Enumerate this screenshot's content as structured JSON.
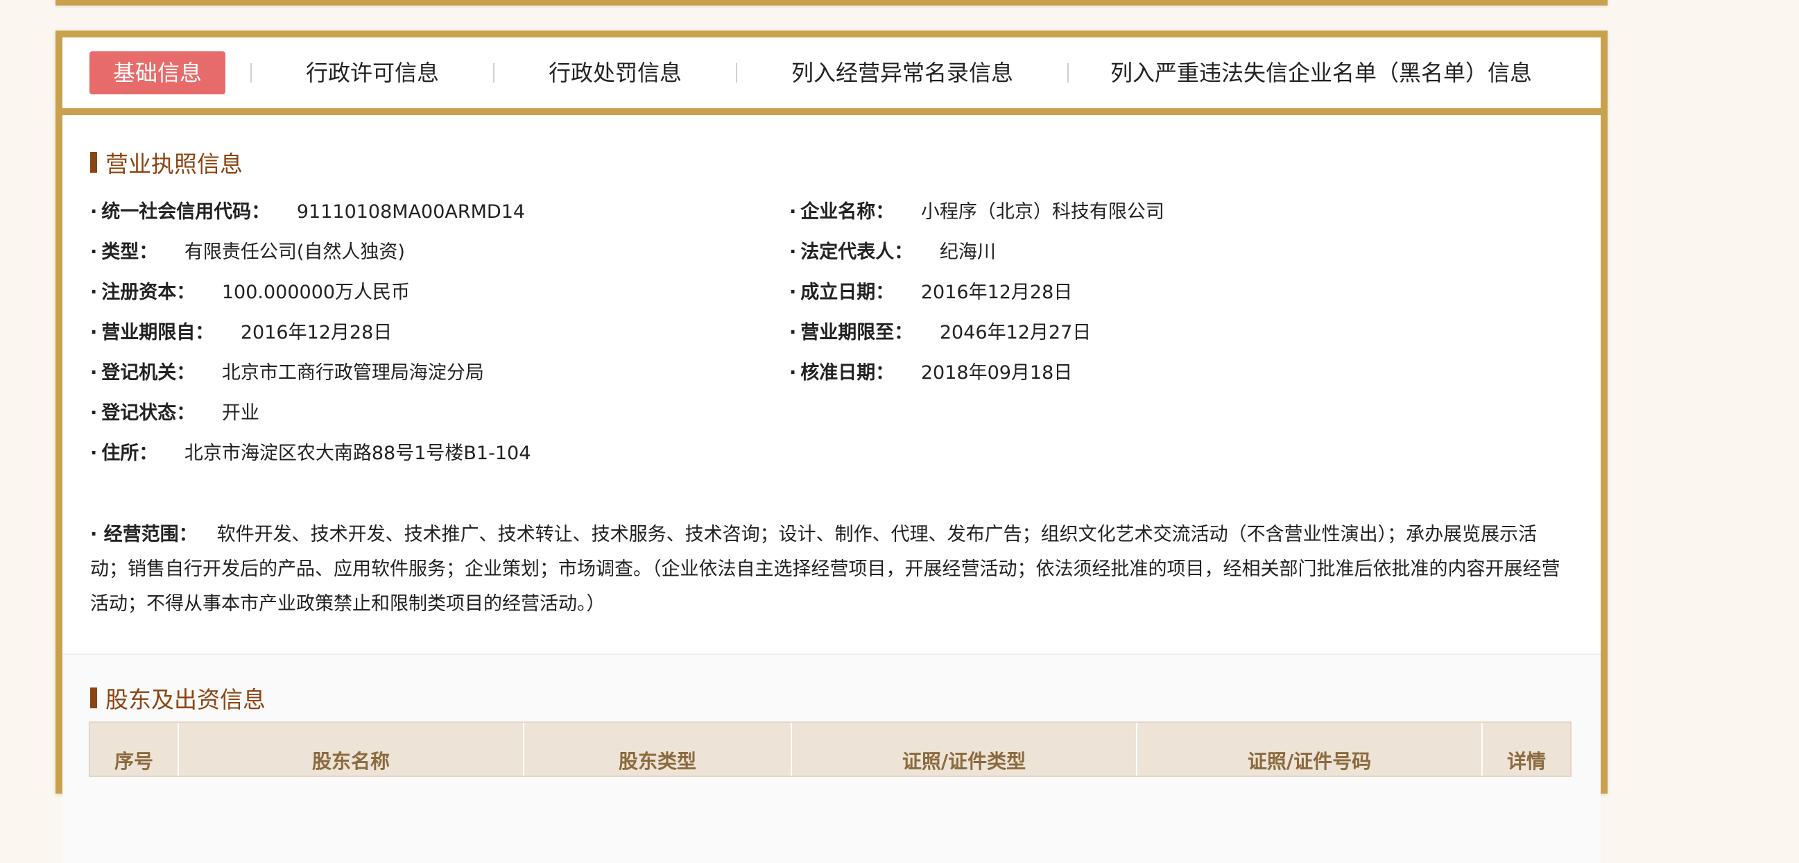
{
  "tabs": [
    {
      "label": "基础信息",
      "active": true
    },
    {
      "label": "行政许可信息",
      "active": false
    },
    {
      "label": "行政处罚信息",
      "active": false
    },
    {
      "label": "列入经营异常名录信息",
      "active": false
    },
    {
      "label": "列入严重违法失信企业名单（黑名单）信息",
      "active": false
    }
  ],
  "license": {
    "title": "营业执照信息",
    "credit_code_label": "统一社会信用代码：",
    "credit_code_value": "91110108MA00ARMD14",
    "name_label": "企业名称：",
    "name_value": "小程序（北京）科技有限公司",
    "type_label": "类型：",
    "type_value": "有限责任公司(自然人独资)",
    "legal_rep_label": "法定代表人：",
    "legal_rep_value": "纪海川",
    "capital_label": "注册资本：",
    "capital_value": "100.000000万人民币",
    "founded_label": "成立日期：",
    "founded_value": "2016年12月28日",
    "term_from_label": "营业期限自：",
    "term_from_value": "2016年12月28日",
    "term_to_label": "营业期限至：",
    "term_to_value": "2046年12月27日",
    "authority_label": "登记机关：",
    "authority_value": "北京市工商行政管理局海淀分局",
    "approved_label": "核准日期：",
    "approved_value": "2018年09月18日",
    "status_label": "登记状态：",
    "status_value": "开业",
    "address_label": "住所：",
    "address_value": "北京市海淀区农大南路88号1号楼B1-104",
    "scope_label": "经营范围：",
    "scope_value": "软件开发、技术开发、技术推广、技术转让、技术服务、技术咨询；设计、制作、代理、发布广告；组织文化艺术交流活动（不含营业性演出）；承办展览展示活动；销售自行开发后的产品、应用软件服务；企业策划；市场调查。（企业依法自主选择经营项目，开展经营活动；依法须经批准的项目，经相关部门批准后依批准的内容开展经营活动；不得从事本市产业政策禁止和限制类项目的经营活动。）"
  },
  "shareholders": {
    "title": "股东及出资信息",
    "columns": [
      "序号",
      "股东名称",
      "股东类型",
      "证照/证件类型",
      "证照/证件号码",
      "详情"
    ]
  },
  "colors": {
    "frame": "#c9a14e",
    "active_tab": "#e86b6b",
    "section_title": "#8b4513",
    "table_header_bg": "#ede3d6"
  }
}
